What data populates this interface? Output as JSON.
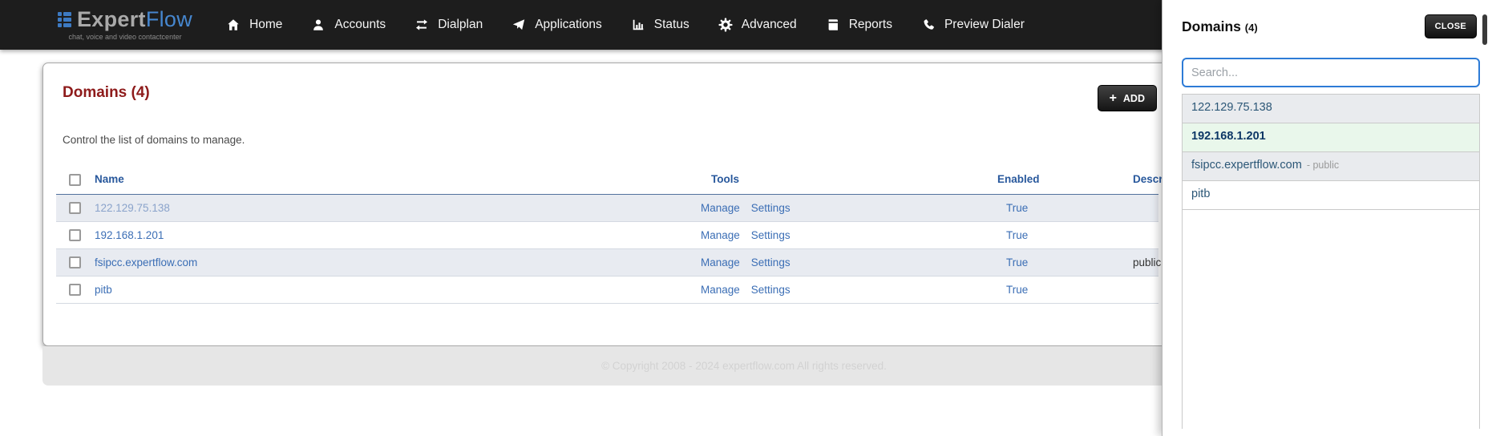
{
  "navbar": {
    "logo": {
      "expert": "Expert",
      "flow": "Flow",
      "tagline": "chat, voice and video contactcenter"
    },
    "items": [
      {
        "label": "Home",
        "icon": "home-icon"
      },
      {
        "label": "Accounts",
        "icon": "user-icon"
      },
      {
        "label": "Dialplan",
        "icon": "transfer-arrows-icon"
      },
      {
        "label": "Applications",
        "icon": "paper-plane-icon"
      },
      {
        "label": "Status",
        "icon": "bar-chart-icon"
      },
      {
        "label": "Advanced",
        "icon": "gear-icon"
      },
      {
        "label": "Reports",
        "icon": "book-icon"
      },
      {
        "label": "Preview Dialer",
        "icon": "phone-icon"
      }
    ]
  },
  "main": {
    "title": "Domains (4)",
    "description": "Control the list of domains to manage.",
    "add_button": "ADD",
    "add_plus": "+",
    "table": {
      "headers": {
        "name": "Name",
        "tools": "Tools",
        "enabled": "Enabled",
        "description": "Description"
      },
      "tools_labels": {
        "manage": "Manage",
        "settings": "Settings"
      },
      "rows": [
        {
          "name": "122.129.75.138",
          "enabled": "True",
          "description": ""
        },
        {
          "name": "192.168.1.201",
          "enabled": "True",
          "description": ""
        },
        {
          "name": "fsipcc.expertflow.com",
          "enabled": "True",
          "description": "public"
        },
        {
          "name": "pitb",
          "enabled": "True",
          "description": ""
        }
      ]
    },
    "footer": "© Copyright 2008 - 2024 expertflow.com All rights reserved."
  },
  "panel": {
    "title": "Domains",
    "count": "(4)",
    "close_button": "CLOSE",
    "search_placeholder": "Search...",
    "items": [
      {
        "label": "122.129.75.138",
        "suffix": ""
      },
      {
        "label": "192.168.1.201",
        "suffix": ""
      },
      {
        "label": "fsipcc.expertflow.com",
        "suffix": "- public"
      },
      {
        "label": "pitb",
        "suffix": ""
      }
    ]
  },
  "colors": {
    "navbar_bg": "#1d1d1d",
    "logo_blue": "#3d7ac2",
    "heading_red": "#8e1b1b",
    "table_header_blue": "#28589c",
    "link_blue": "#3b6eb5",
    "row_alt_bg": "#e8ebf1",
    "panel_active_bg": "#e9f7eb",
    "search_border_blue": "#2d7bd6",
    "button_dark": "#141414",
    "footer_bg": "#e6e6e6"
  }
}
